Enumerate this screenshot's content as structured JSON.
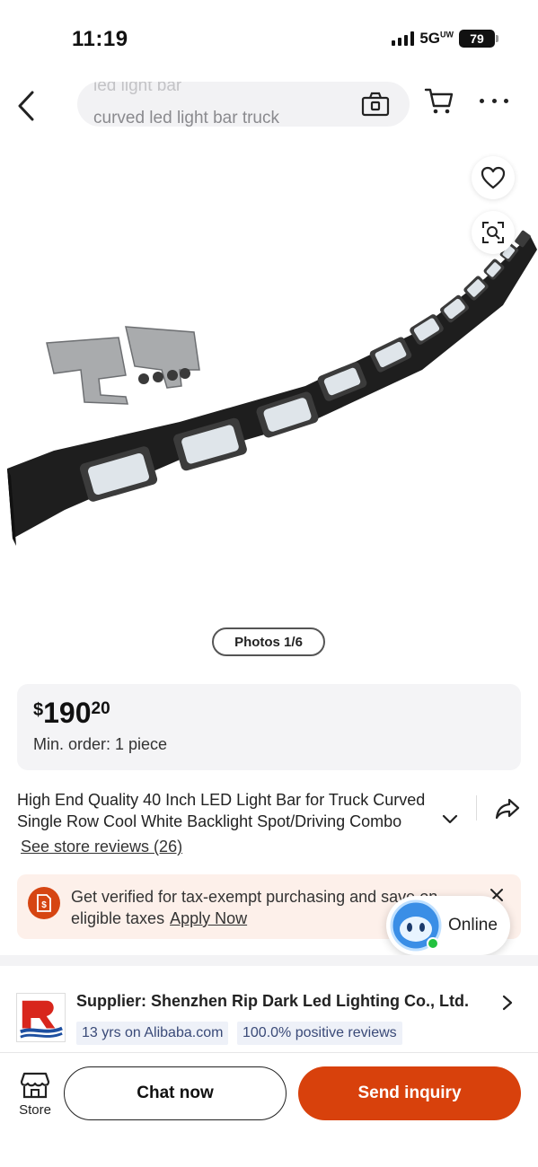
{
  "status_bar": {
    "time": "11:19",
    "network": "5G",
    "network_suffix": "UW",
    "battery": "79"
  },
  "header": {
    "search_text": "curved led light bar truck",
    "search_ghost_text": "led light bar",
    "icons": [
      "back-chevron-icon",
      "camera-icon",
      "cart-icon",
      "more-icon"
    ]
  },
  "gallery": {
    "photos_indicator": "Photos 1/6",
    "icons": [
      "heart-icon",
      "visual-search-icon"
    ]
  },
  "price": {
    "currency": "$",
    "integer": "190",
    "decimal": "20",
    "min_order": "Min. order: 1 piece"
  },
  "product": {
    "title_line1": "High End Quality 40 Inch LED Light Bar for Truck Curved",
    "title_line2": "Single Row Cool White Backlight Spot/Driving Combo",
    "reviews_link": "See store reviews (26)"
  },
  "tax_banner": {
    "text": "Get verified for tax-exempt purchasing and save on eligible taxes",
    "apply_label": "Apply Now"
  },
  "online": {
    "label": "Online"
  },
  "supplier": {
    "name": "Supplier: Shenzhen Rip Dark Led Lighting Co., Ltd.",
    "badge_years": "13 yrs on Alibaba.com",
    "badge_reviews": "100.0% positive reviews"
  },
  "bottom_bar": {
    "store_label": "Store",
    "chat_label": "Chat now",
    "inquiry_label": "Send inquiry"
  },
  "colors": {
    "accent": "#d8410c",
    "banner_bg": "#fdf0ea",
    "badge_bg": "#eef1f8",
    "online_dot": "#23c13f"
  }
}
